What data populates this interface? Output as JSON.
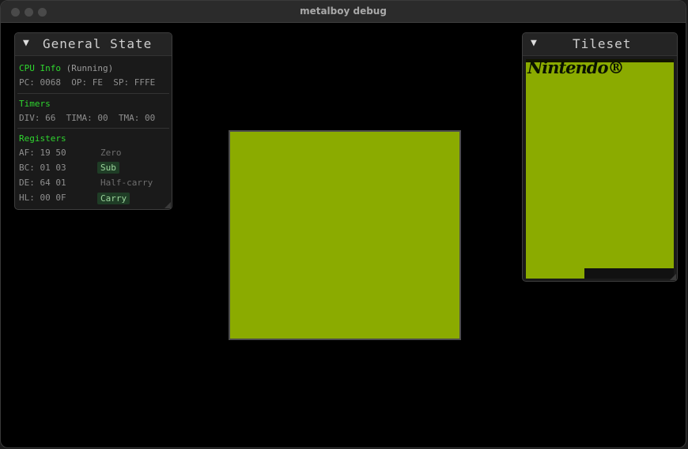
{
  "window": {
    "title": "metalboy debug"
  },
  "general_state": {
    "title": "General State",
    "collapse_glyph": "▼",
    "cpu": {
      "heading": "CPU Info",
      "status": "(Running)",
      "pc_label": "PC:",
      "pc": "0068",
      "op_label": "OP:",
      "op": "FE",
      "sp_label": "SP:",
      "sp": "FFFE"
    },
    "timers": {
      "heading": "Timers",
      "div_label": "DIV:",
      "div": "66",
      "tima_label": "TIMA:",
      "tima": "00",
      "tma_label": "TMA:",
      "tma": "00"
    },
    "registers": {
      "heading": "Registers",
      "af_label": "AF:",
      "af": "19 50",
      "bc_label": "BC:",
      "bc": "01 03",
      "de_label": "DE:",
      "de": "64 01",
      "hl_label": "HL:",
      "hl": "00 0F"
    },
    "flags": {
      "zero": "Zero",
      "sub": "Sub",
      "half_carry": "Half-carry",
      "carry": "Carry",
      "zero_set": false,
      "sub_set": true,
      "half_carry_set": false,
      "carry_set": true
    }
  },
  "tileset": {
    "title": "Tileset",
    "collapse_glyph": "▼",
    "logo_text": "Nintendo®"
  },
  "colors": {
    "lcd_green": "#8bab00",
    "accent_green": "#2fd62f",
    "flag_active_bg": "#1f3d26"
  }
}
